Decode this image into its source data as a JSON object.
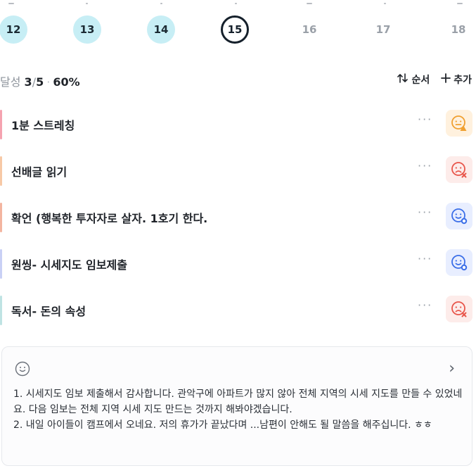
{
  "calendar": {
    "days": [
      {
        "label": "12",
        "state": "done"
      },
      {
        "label": "13",
        "state": "done"
      },
      {
        "label": "14",
        "state": "done"
      },
      {
        "label": "15",
        "state": "today"
      },
      {
        "label": "16",
        "state": "future"
      },
      {
        "label": "17",
        "state": "future"
      },
      {
        "label": "18",
        "state": "future"
      }
    ]
  },
  "summary": {
    "label": "달성",
    "done": "3",
    "sep": "/",
    "total": "5",
    "dot": "·",
    "percent": "60%",
    "order_label": "순서",
    "add_label": "추가"
  },
  "habits": [
    {
      "title": "1분 스트레칭",
      "more": "···",
      "mood": "warning-face-icon",
      "bar_color": "#f5a3b0",
      "face_color": "#f0a030"
    },
    {
      "title": "선배글 읽기",
      "more": "···",
      "mood": "fail-face-icon",
      "bar_color": "#f7c9a6",
      "face_color": "#e8554a"
    },
    {
      "title": "확언 (행복한 투자자로 살자. 1호기 한다.",
      "more": "···",
      "mood": "done-face-icon",
      "bar_color": "#f3b5a0",
      "face_color": "#3a6ee8"
    },
    {
      "title": "원씽- 시세지도 임보제출",
      "more": "···",
      "mood": "done-face-icon",
      "bar_color": "#c9d0f5",
      "face_color": "#3a6ee8"
    },
    {
      "title": "독서- 돈의 속성",
      "more": "···",
      "mood": "fail-face-icon",
      "bar_color": "#bfe3e3",
      "face_color": "#e8554a"
    }
  ],
  "memo": {
    "chevron": "›",
    "line1": "1. 시세지도 임보 제출해서 감사합니다. 관악구에 아파트가 많지 않아 전체 지역의 시세 지도를 만들 수 있었네요. 다음 임보는 전체 지역 시세 지도 만드는 것까지 해봐야겠습니다.",
    "line2": "2. 내일 아이들이 캠프에서 오네요. 저의 휴가가 끝났다며 ...남편이 안해도 될 말씀을 해주십니다. ㅎㅎ"
  },
  "colors": {
    "accent_done": "#c7eef5",
    "today_ring": "#15202b",
    "muted": "#9aa0a8"
  }
}
